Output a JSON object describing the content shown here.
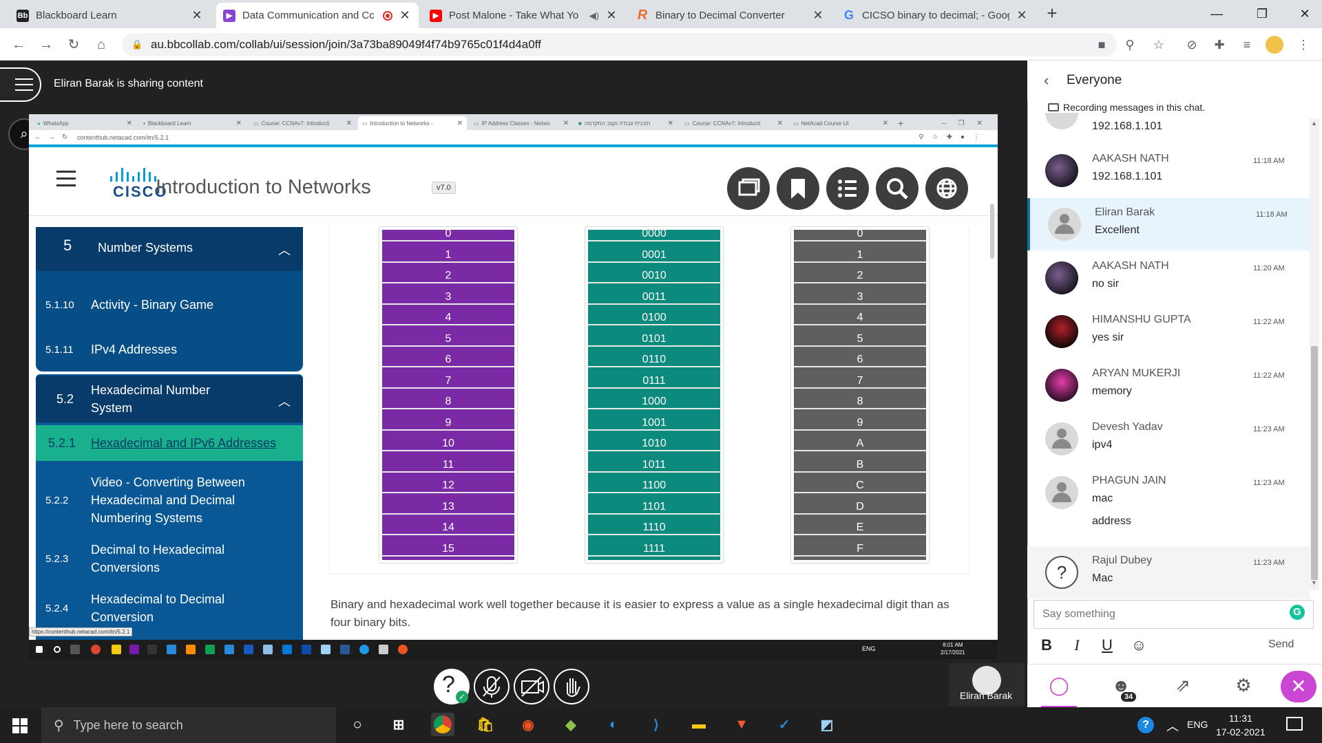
{
  "browser": {
    "tabs": [
      {
        "title": "Blackboard Learn",
        "icon": "blackboard-icon",
        "active": false
      },
      {
        "title": "Data Communication and Cc",
        "icon": "collab-icon",
        "active": true,
        "recording": true
      },
      {
        "title": "Post Malone - Take What Yo",
        "icon": "youtube-icon",
        "active": false,
        "muted": true
      },
      {
        "title": "Binary to Decimal Converter",
        "icon": "rapidtables-icon",
        "active": false
      },
      {
        "title": "CICSO binary to decimal; - Googl",
        "icon": "google-icon",
        "active": false
      }
    ],
    "url": "au.bbcollab.com/collab/ui/session/join/3a73ba89049f4f74b9765c01f4d4a0ff",
    "window_controls": [
      "—",
      "❐",
      "✕"
    ]
  },
  "collab": {
    "sharing_label": "Eliran Barak is sharing content",
    "presenter_name": "Eliran Barak"
  },
  "shared_screen": {
    "tabs": [
      {
        "title": "WhatsApp"
      },
      {
        "title": "Blackboard Learn"
      },
      {
        "title": "Course: CCNAv7: Introducti"
      },
      {
        "title": "Introduction to Networks -",
        "active": true
      },
      {
        "title": "IP Address Classes - Netwo"
      },
      {
        "title": "תוכנית עבודה וקצב התקדמה"
      },
      {
        "title": "Course: CCNAv7: Introducti"
      },
      {
        "title": "NetAcad Course UI"
      }
    ],
    "url": "contenthub.netacad.com/itn/5.2.1",
    "hover_url": "https://contenthub.netacad.com/itn/5.2.1",
    "logo_text": "CISCO",
    "course_title": "Introduction to Networks",
    "version": "v7.0",
    "sidebar": {
      "module": {
        "num": "5",
        "label": "Number Systems"
      },
      "items": [
        {
          "num": "5.1.10",
          "label": "Activity - Binary Game"
        },
        {
          "num": "5.1.11",
          "label": "IPv4 Addresses"
        }
      ],
      "section": {
        "num": "5.2",
        "label": "Hexadecimal Number System"
      },
      "sub_items": [
        {
          "num": "5.2.1",
          "label": "Hexadecimal and IPv6 Addresses",
          "active": true
        },
        {
          "num": "5.2.2",
          "label": "Video - Converting Between Hexadecimal and Decimal Numbering Systems"
        },
        {
          "num": "5.2.3",
          "label": "Decimal to Hexadecimal Conversions"
        },
        {
          "num": "5.2.4",
          "label": "Hexadecimal to Decimal Conversion"
        }
      ]
    },
    "table": {
      "decimal": [
        "0",
        "1",
        "2",
        "3",
        "4",
        "5",
        "6",
        "7",
        "8",
        "9",
        "10",
        "11",
        "12",
        "13",
        "14",
        "15"
      ],
      "binary": [
        "0000",
        "0001",
        "0010",
        "0011",
        "0100",
        "0101",
        "0110",
        "0111",
        "1000",
        "1001",
        "1010",
        "1011",
        "1100",
        "1101",
        "1110",
        "1111"
      ],
      "hex": [
        "0",
        "1",
        "2",
        "3",
        "4",
        "5",
        "6",
        "7",
        "8",
        "9",
        "A",
        "B",
        "C",
        "D",
        "E",
        "F"
      ],
      "colors": {
        "decimal": "#7a2aa5",
        "binary": "#0c8a7e",
        "hex": "#5f5f5f"
      }
    },
    "paragraph": "Binary and hexadecimal work well together because it is easier to express a value as a single hexadecimal digit than as four binary bits.",
    "taskbar_time": "8:01 AM",
    "taskbar_date": "2/17/2021",
    "taskbar_lang": "ENG"
  },
  "chat": {
    "title": "Everyone",
    "recording_note": "Recording messages in this chat.",
    "partial_message": "192.168.1.101",
    "messages": [
      {
        "name": "AAKASH NATH",
        "text": "192.168.1.101",
        "time": "11:18 AM",
        "avatar": "photo"
      },
      {
        "name": "Eliran Barak",
        "text": "Excellent",
        "time": "11:18 AM",
        "avatar": "default",
        "highlight": true
      },
      {
        "name": "AAKASH NATH",
        "text": "no sir",
        "time": "11:20 AM",
        "avatar": "photo"
      },
      {
        "name": "HIMANSHU GUPTA",
        "text": "yes sir",
        "time": "11:22 AM",
        "avatar": "red"
      },
      {
        "name": "ARYAN MUKERJI",
        "text": "memory",
        "time": "11:22 AM",
        "avatar": "pink"
      },
      {
        "name": "Devesh Yadav",
        "text": "ipv4",
        "time": "11:23 AM",
        "avatar": "default"
      },
      {
        "name": "PHAGUN JAIN",
        "text": "mac",
        "time": "11:23 AM",
        "avatar": "default",
        "extra": "address"
      },
      {
        "name": "Rajul Dubey",
        "text": "Mac",
        "time": "11:23 AM",
        "avatar": "question"
      }
    ],
    "input_placeholder": "Say something",
    "send_label": "Send",
    "format_buttons": [
      "B",
      "I",
      "U"
    ],
    "participants_count": "34"
  },
  "windows": {
    "search_placeholder": "Type here to search",
    "time": "11:31",
    "date": "17-02-2021",
    "lang": "ENG"
  }
}
